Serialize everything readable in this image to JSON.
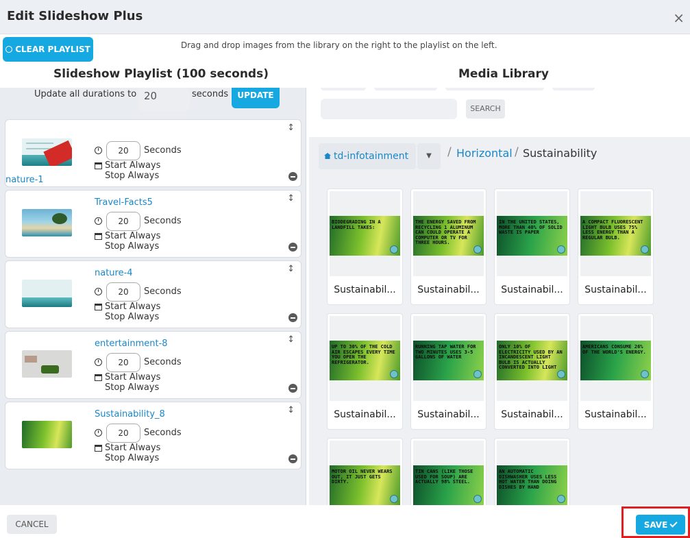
{
  "dialog": {
    "title": "Edit Slideshow Plus",
    "close_glyph": "×"
  },
  "toolbar": {
    "clear_label": "CLEAR PLAYLIST",
    "hint": "Drag and drop images from the library on the right to the playlist on the left."
  },
  "playlist": {
    "title": "Slideshow Playlist (100 seconds)",
    "update_label": "Update all durations to",
    "update_value": "20",
    "update_unit": "seconds",
    "update_button": "UPDATE",
    "items": [
      {
        "name": "nature-1",
        "duration": "20",
        "unit": "Seconds",
        "start": "Start Always",
        "stop": "Stop Always"
      },
      {
        "name": "Travel-Facts5",
        "duration": "20",
        "unit": "Seconds",
        "start": "Start Always",
        "stop": "Stop Always"
      },
      {
        "name": "nature-4",
        "duration": "20",
        "unit": "Seconds",
        "start": "Start Always",
        "stop": "Stop Always"
      },
      {
        "name": "entertainment-8",
        "duration": "20",
        "unit": "Seconds",
        "start": "Start Always",
        "stop": "Stop Always"
      },
      {
        "name": "Sustainability_8",
        "duration": "20",
        "unit": "Seconds",
        "start": "Start Always",
        "stop": "Stop Always"
      }
    ]
  },
  "library": {
    "title": "Media Library",
    "search_button": "SEARCH",
    "breadcrumb": {
      "home": "td-infotainment",
      "sep": "/",
      "folder": "Horizontal",
      "current": "Sustainability"
    },
    "tiles": [
      {
        "caption": "Sustainabil...",
        "image_text": "Biodegrading in a landfill takes:"
      },
      {
        "caption": "Sustainabil...",
        "image_text": "The energy saved from recycling 1 aluminum can could operate a computer or TV for three hours."
      },
      {
        "caption": "Sustainabil...",
        "image_text": "In the United States, more than 40% of solid waste is paper"
      },
      {
        "caption": "Sustainabil...",
        "image_text": "A compact fluorescent light bulb uses 75% less energy than a regular bulb."
      },
      {
        "caption": "Sustainabil...",
        "image_text": "Up to 30% of the cold air escapes every time you open the refrigerator."
      },
      {
        "caption": "Sustainabil...",
        "image_text": "Running tap water for two minutes uses 3-5 gallons of water"
      },
      {
        "caption": "Sustainabil...",
        "image_text": "Only 10% of electricity used by an incandescent light bulb is actually converted into light"
      },
      {
        "caption": "Sustainabil...",
        "image_text": "Americans consume 26% of the world's energy."
      },
      {
        "caption": "",
        "image_text": "Motor oil never wears out, it just gets dirty."
      },
      {
        "caption": "",
        "image_text": "Tin cans (like those used for soup) are actually 98% steel."
      },
      {
        "caption": "",
        "image_text": "An automatic dishwasher uses less hot water than doing dishes by hand"
      }
    ]
  },
  "footer": {
    "cancel_label": "CANCEL",
    "save_label": "SAVE"
  },
  "colors": {
    "accent": "#16a9e1",
    "link": "#1a87c8",
    "highlight_border": "#e02020"
  }
}
